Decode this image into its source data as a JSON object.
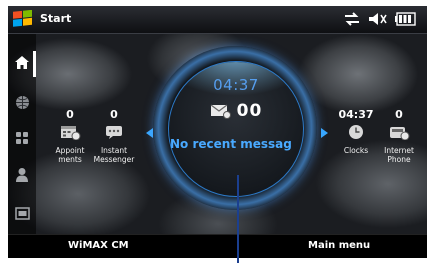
{
  "titlebar": {
    "title": "Start",
    "status_icons": [
      "connectivity-icon",
      "volume-icon",
      "battery-icon"
    ]
  },
  "sidebar": {
    "items": [
      {
        "name": "home",
        "icon": "home-icon",
        "active": true
      },
      {
        "name": "internet",
        "icon": "globe-icon",
        "active": false
      },
      {
        "name": "programs",
        "icon": "grid-icon",
        "active": false
      },
      {
        "name": "contacts",
        "icon": "person-icon",
        "active": false
      },
      {
        "name": "photos",
        "icon": "picture-icon",
        "active": false
      }
    ]
  },
  "widgets": {
    "appointments": {
      "count": "0",
      "label": "Appoint ments",
      "icon": "calendar-icon"
    },
    "instant_messenger": {
      "count": "0",
      "label": "Instant Messenger",
      "icon": "chat-icon"
    },
    "clocks": {
      "count": "04:37",
      "label": "Clocks",
      "icon": "clock-icon"
    },
    "internet_phone": {
      "count": "0",
      "label": "Internet Phone",
      "icon": "phone-icon"
    }
  },
  "dial": {
    "time": "04:37",
    "message_count": "00",
    "status_text": "No recent messag"
  },
  "softkeys": {
    "left": "WiMAX CM",
    "right": "Main menu"
  },
  "colors": {
    "accent": "#49a9ff",
    "background": "#0a0c10"
  }
}
